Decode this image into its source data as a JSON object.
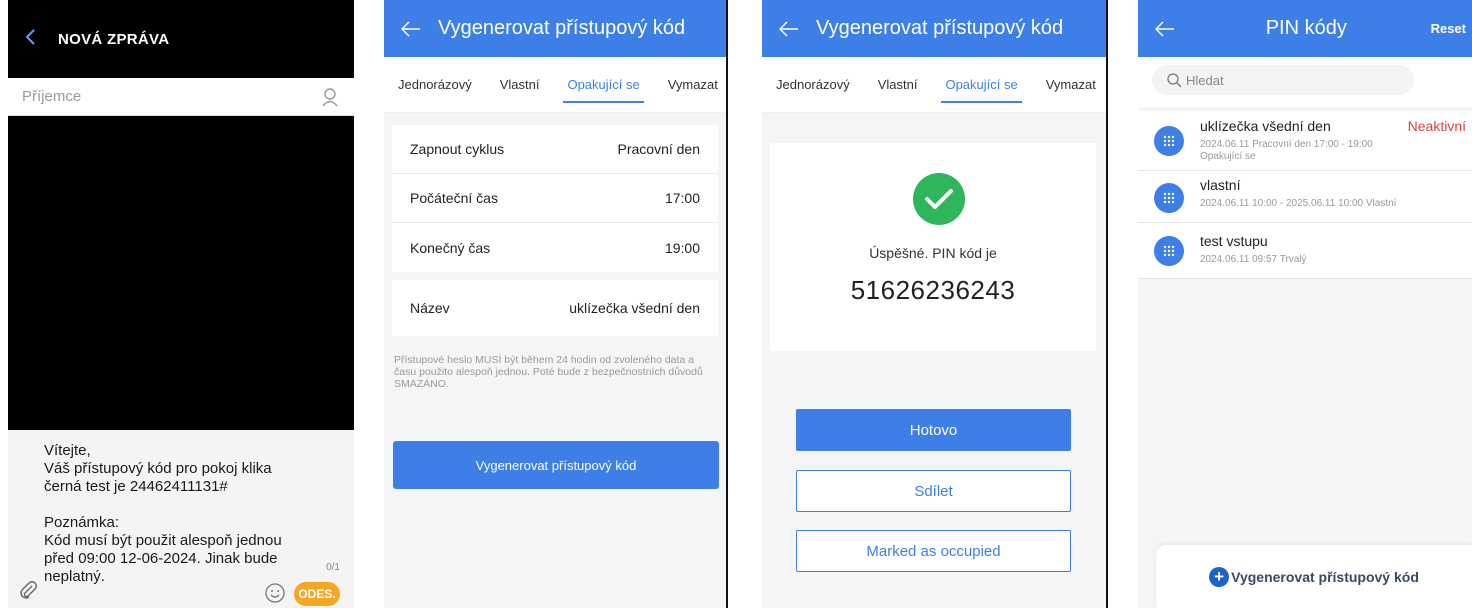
{
  "sms": {
    "title": "NOVÁ ZPRÁVA",
    "recipient_placeholder": "Příjemce",
    "message": "Vítejte,\nVáš přístupový kód pro pokoj klika černá test je 24462411131#\n\nPoznámka:\nKód musí být použit alespoň jednou před 09:00 12-06-2024. Jinak bude neplatný.",
    "counter": "0/1",
    "send_label": "ODES."
  },
  "form_screen": {
    "title": "Vygenerovat přístupový kód",
    "tabs": [
      "Jednorázový",
      "Vlastní",
      "Opakující se",
      "Vymazat"
    ],
    "active_tab": "Opakující se",
    "rows": [
      {
        "label": "Zapnout cyklus",
        "value": "Pracovní den"
      },
      {
        "label": "Počáteční čas",
        "value": "17:00"
      },
      {
        "label": "Konečný čas",
        "value": "19:00"
      }
    ],
    "name_row": {
      "label": "Název",
      "value": "uklízečka všední den"
    },
    "note": "Přístupové heslo MUSÍ být během 24 hodin od zvoleného data a času použito alespoň jednou. Poté bude z bezpečnostních důvodů SMAZÁNO.",
    "generate_label": "Vygenerovat přístupový kód"
  },
  "success_screen": {
    "title": "Vygenerovat přístupový kód",
    "tabs": [
      "Jednorázový",
      "Vlastní",
      "Opakující se",
      "Vymazat"
    ],
    "success_text": "Úspěšné. PIN kód je",
    "pin": "51626236243",
    "done_label": "Hotovo",
    "share_label": "Sdílet",
    "occupied_label": "Marked as occupied"
  },
  "pin_list": {
    "title": "PIN kódy",
    "reset_label": "Reset",
    "search_placeholder": "Hledat",
    "items": [
      {
        "name": "uklízečka všední den",
        "detail": "2024.06.11   Pracovní den 17:00 - 19:00",
        "detail2": "Opakující se",
        "status": "Neaktivní"
      },
      {
        "name": "vlastní",
        "detail": "2024.06.11 10:00 - 2025.06.11 10:00   Vlastní"
      },
      {
        "name": "test vstupu",
        "detail": "2024.06.11 09:57   Trvalý"
      }
    ],
    "generate_label": "Vygenerovat přístupový kód"
  },
  "colors": {
    "primary": "#3d7fe6",
    "success": "#2fb55a",
    "inactive": "#e0403a",
    "send": "#f5a623"
  }
}
